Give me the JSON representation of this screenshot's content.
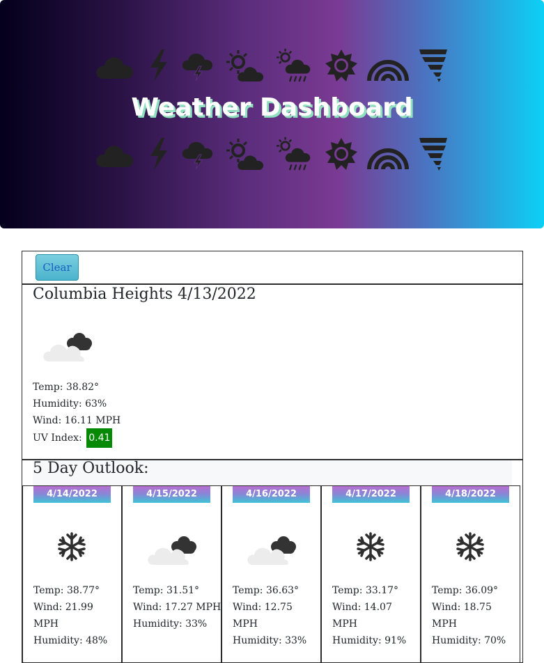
{
  "header": {
    "title": "Weather Dashboard",
    "icons": [
      "cloud-icon",
      "lightning-icon",
      "thunderstorm-icon",
      "partly-sunny-icon",
      "sun-rain-icon",
      "sun-icon",
      "rainbow-icon",
      "tornado-icon"
    ]
  },
  "toolbar": {
    "clear_label": "Clear"
  },
  "current": {
    "title": "Columbia Heights 4/13/2022",
    "icon": "partly-cloudy-icon",
    "temp": "Temp: 38.82°",
    "humidity": "Humidity: 63%",
    "wind": "Wind: 16.11 MPH",
    "uv_label": "UV Index:",
    "uv_value": "0.41",
    "uv_color": "#068a06"
  },
  "outlook": {
    "title": "5 Day Outlook:",
    "days": [
      {
        "date": "4/14/2022",
        "icon": "snowflake-icon",
        "temp": "Temp: 38.77°",
        "wind_1": "Wind: 21.99",
        "wind_2": "MPH",
        "humidity": "Humidity: 48%"
      },
      {
        "date": "4/15/2022",
        "icon": "partly-cloudy-icon",
        "temp": "Temp: 31.51°",
        "wind_1": "Wind: 17.27 MPH",
        "wind_2": "",
        "humidity": "Humidity: 33%"
      },
      {
        "date": "4/16/2022",
        "icon": "partly-cloudy-icon",
        "temp": "Temp: 36.63°",
        "wind_1": "Wind: 12.75",
        "wind_2": "MPH",
        "humidity": "Humidity: 33%"
      },
      {
        "date": "4/17/2022",
        "icon": "snowflake-icon",
        "temp": "Temp: 33.17°",
        "wind_1": "Wind: 14.07",
        "wind_2": "MPH",
        "humidity": "Humidity: 91%"
      },
      {
        "date": "4/18/2022",
        "icon": "snowflake-icon",
        "temp": "Temp: 36.09°",
        "wind_1": "Wind: 18.75",
        "wind_2": "MPH",
        "humidity": "Humidity: 70%"
      }
    ]
  }
}
